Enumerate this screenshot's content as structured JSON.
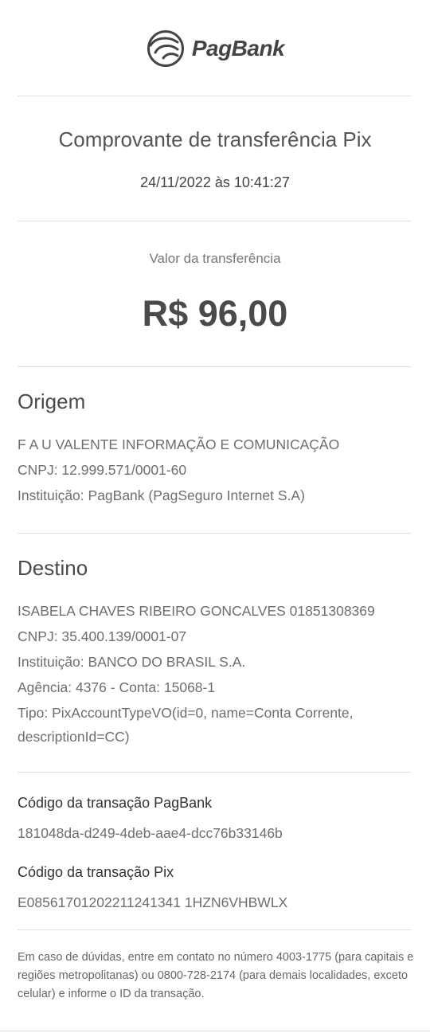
{
  "header": {
    "brand": "PagBank",
    "logo_icon": "pagbank-logo-icon"
  },
  "receipt": {
    "title": "Comprovante de transferência Pix",
    "datetime": "24/11/2022 às 10:41:27",
    "amount_label": "Valor da transferência",
    "amount": "R$ 96,00"
  },
  "origin": {
    "title": "Origem",
    "name": "F A U VALENTE INFORMAÇÃO E COMUNICAÇÃO",
    "cnpj": "CNPJ: 12.999.571/0001-60",
    "institution": "Instituição: PagBank (PagSeguro Internet S.A)"
  },
  "destination": {
    "title": "Destino",
    "name": "ISABELA CHAVES RIBEIRO GONCALVES 01851308369",
    "cnpj": "CNPJ: 35.400.139/0001-07",
    "institution": "Instituição: BANCO DO BRASIL S.A.",
    "branch_account": "Agência: 4376 - Conta: 15068-1",
    "type_line1": "Tipo: PixAccountTypeVO(id=0, name=Conta Corrente,",
    "type_line2": "descriptionId=CC)"
  },
  "codes": {
    "pagbank_label": "Código da transação PagBank",
    "pagbank_value": "181048da-d249-4deb-aae4-dcc76b33146b",
    "pix_label": "Código da transação Pix",
    "pix_value": "E08561701202211241341 1HZN6VHBWLX"
  },
  "footer": {
    "text": "Em caso de dúvidas, entre em contato no número 4003-1775 (para capitais e regiões metropolitanas) ou 0800-728-2174 (para demais localidades, exceto celular) e informe o ID da transação."
  }
}
